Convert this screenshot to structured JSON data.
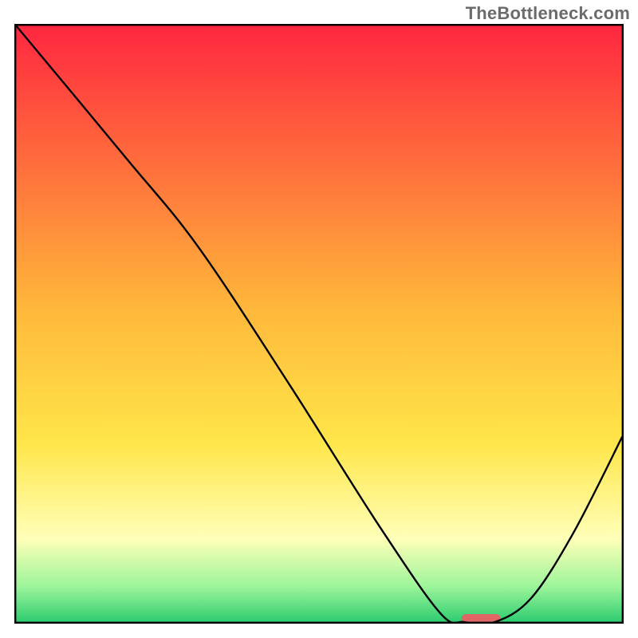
{
  "watermark": "TheBottleneck.com",
  "colors": {
    "gradient_top": "#ff2740",
    "gradient_upper": "#ff6a3c",
    "gradient_mid": "#ffb93b",
    "gradient_lower_mid": "#ffe64a",
    "gradient_pale": "#ffffb8",
    "gradient_green_light": "#9df59a",
    "gradient_green": "#2ecc71",
    "curve": "#000000",
    "frame": "#000000",
    "marker": "#e06666"
  },
  "chart_data": {
    "type": "line",
    "title": "",
    "xlabel": "",
    "ylabel": "",
    "x": [
      0.0,
      0.18,
      0.3,
      0.45,
      0.6,
      0.7,
      0.74,
      0.79,
      0.85,
      0.92,
      1.0
    ],
    "y": [
      1.0,
      0.78,
      0.63,
      0.4,
      0.16,
      0.015,
      0.0,
      0.0,
      0.04,
      0.15,
      0.31
    ],
    "xlim": [
      0.0,
      1.0
    ],
    "ylim": [
      0.0,
      1.0
    ],
    "marker": {
      "x_start": 0.735,
      "x_end": 0.8,
      "y": 0.0
    },
    "grid": false,
    "legend": false
  }
}
